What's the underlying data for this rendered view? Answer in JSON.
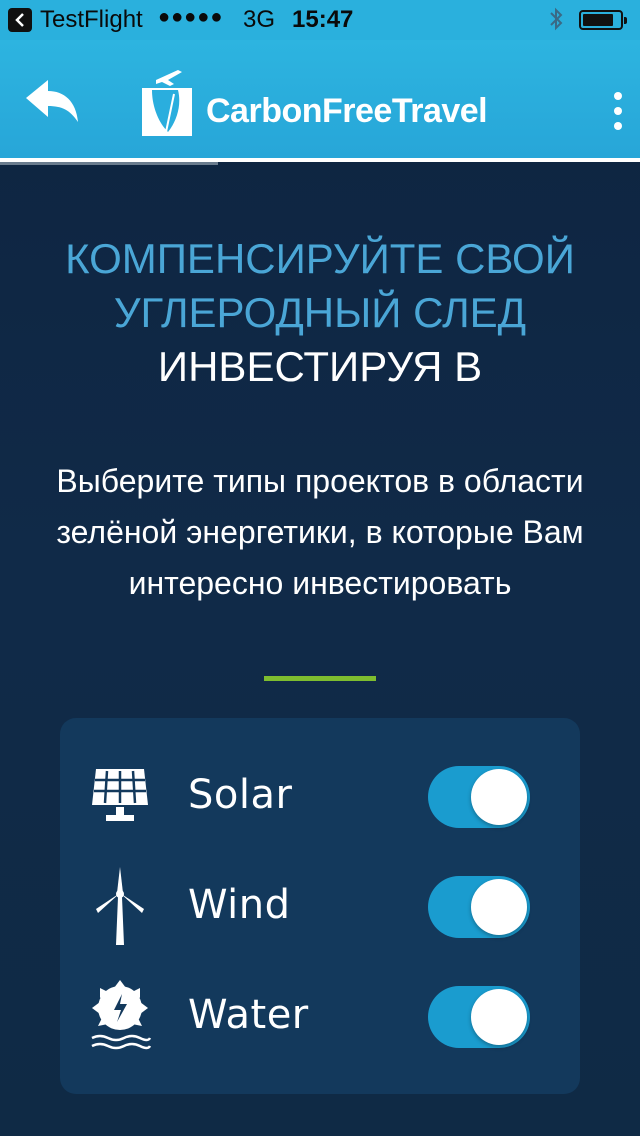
{
  "status_bar": {
    "app_name": "TestFlight",
    "signal": "●●●●●",
    "network": "3G",
    "time": "15:47",
    "bluetooth": "✱"
  },
  "nav": {
    "brand": "CarbonFreeTravel",
    "back_icon": "reply-arrow-icon",
    "menu_icon": "more-vertical-icon"
  },
  "headline": {
    "line1": "КОМПЕНСИРУЙТЕ СВОЙ",
    "line2": "УГЛЕРОДНЫЙ СЛЕД",
    "line3": "ИНВЕСТИРУЯ В"
  },
  "subtitle": "Выберите типы проектов в области зелёной энергетики, в которые Вам интересно инвестировать",
  "options": [
    {
      "label": "Solar",
      "icon": "solar-panel-icon",
      "enabled": true
    },
    {
      "label": "Wind",
      "icon": "wind-turbine-icon",
      "enabled": true
    },
    {
      "label": "Water",
      "icon": "water-turbine-icon",
      "enabled": true
    }
  ],
  "colors": {
    "accent_blue": "#2ab0dd",
    "headline_blue": "#4aa6d6",
    "divider_green": "#7ebd2f",
    "toggle_on": "#1a9ccf",
    "background": "#0e2440",
    "card": "#13395c"
  }
}
